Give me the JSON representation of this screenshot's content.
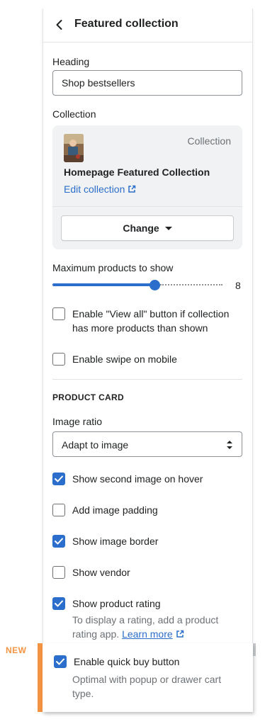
{
  "header": {
    "title": "Featured collection"
  },
  "heading_field": {
    "label": "Heading",
    "value": "Shop bestsellers"
  },
  "collection": {
    "label": "Collection",
    "type_label": "Collection",
    "name": "Homepage Featured Collection",
    "edit_label": "Edit collection",
    "change_label": "Change"
  },
  "max_products": {
    "label": "Maximum products to show",
    "value": 8,
    "min": 2,
    "max": 12
  },
  "options_top": [
    {
      "label": "Enable \"View all\" button if collection has more products than shown",
      "checked": false
    },
    {
      "label": "Enable swipe on mobile",
      "checked": false
    }
  ],
  "product_card": {
    "section_title": "PRODUCT CARD",
    "image_ratio": {
      "label": "Image ratio",
      "value": "Adapt to image"
    },
    "options": [
      {
        "label": "Show second image on hover",
        "checked": true
      },
      {
        "label": "Add image padding",
        "checked": false
      },
      {
        "label": "Show image border",
        "checked": true
      },
      {
        "label": "Show vendor",
        "checked": false
      },
      {
        "label": "Show product rating",
        "checked": true
      }
    ],
    "rating_help": {
      "text": "To display a rating, add a product rating app.",
      "link": "Learn more"
    }
  },
  "new_feature": {
    "tag": "NEW",
    "label": "Enable quick buy button",
    "checked": true,
    "help": "Optimal with popup or drawer cart type."
  },
  "colors": {
    "accent": "#2c6ecb",
    "new_badge": "#f49342",
    "border": "#8c9196",
    "muted_text": "#6d7175"
  }
}
